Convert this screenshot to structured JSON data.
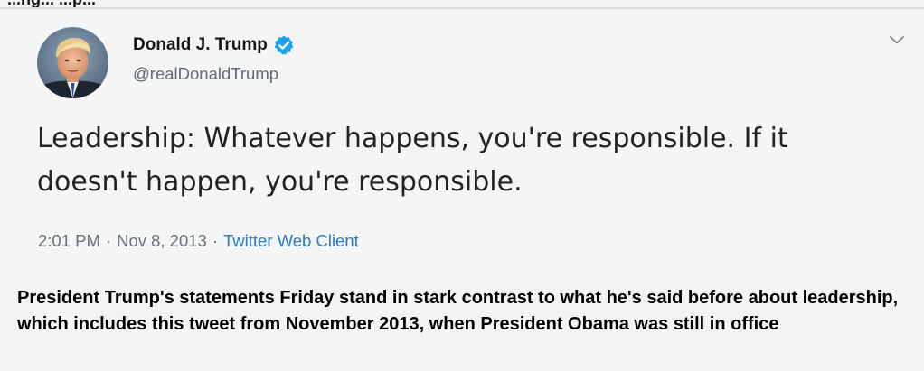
{
  "top_strip": {
    "text": "...ng... ...p..."
  },
  "tweet": {
    "author": {
      "display_name": "Donald J. Trump",
      "handle": "@realDonaldTrump",
      "verified": true,
      "avatar_icon": "profile-photo"
    },
    "more_menu_icon": "chevron-down-icon",
    "text": "Leadership: Whatever happens, you're responsible. If it doesn't happen, you're responsible.",
    "time": "2:01 PM",
    "separator": "·",
    "date": "Nov 8, 2013",
    "client": "Twitter Web Client",
    "colors": {
      "verified_blue": "#1da1f2",
      "link_blue": "#2a7bbf"
    }
  },
  "caption": {
    "text": "President Trump's statements Friday stand in stark contrast to what he's said before about leadership, which includes this tweet from November 2013, when President Obama was still in office"
  }
}
